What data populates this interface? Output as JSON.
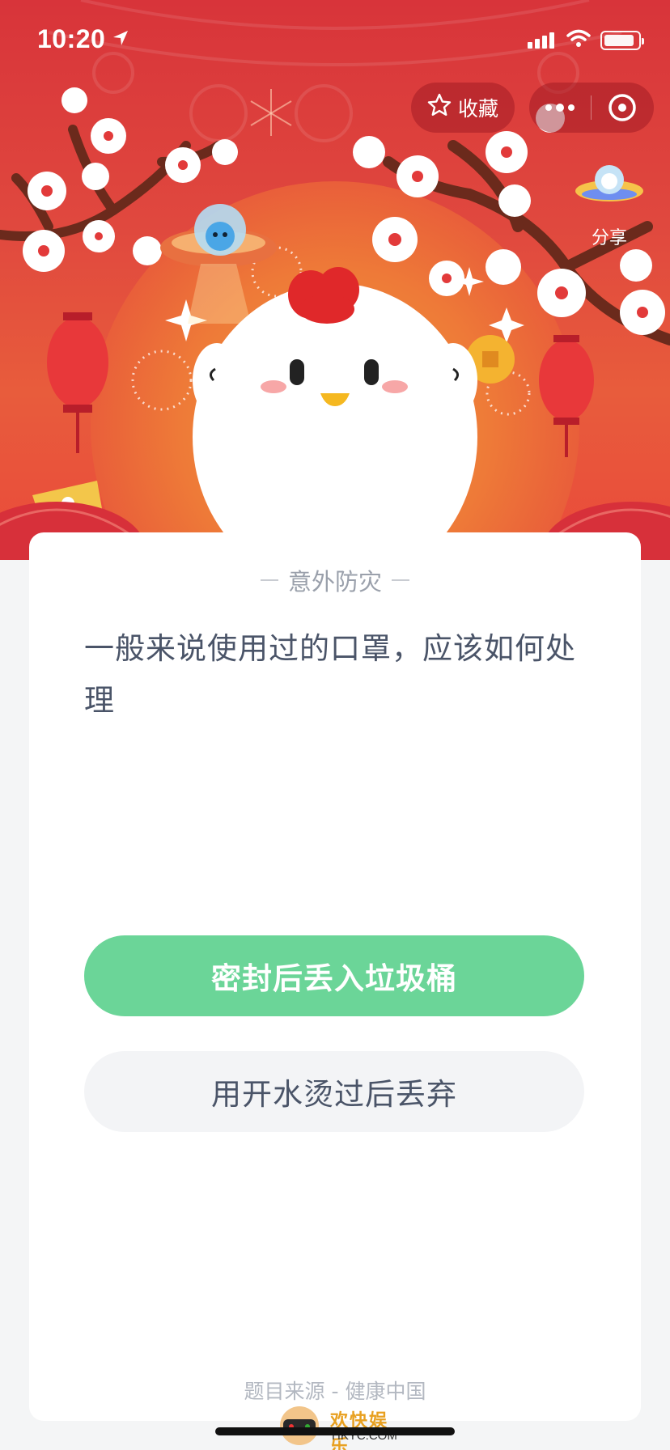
{
  "status_bar": {
    "time": "10:20"
  },
  "header": {
    "favorite_label": "收藏",
    "share_label": "分享"
  },
  "quiz": {
    "category": "意外防灾",
    "question": "一般来说使用过的口罩，应该如何处理",
    "options": [
      {
        "label": "密封后丢入垃圾桶",
        "state": "highlighted"
      },
      {
        "label": "用开水烫过后丢弃",
        "state": "default"
      }
    ],
    "source": "题目来源 - 健康中国"
  },
  "watermark": {
    "title": "欢快娱乐",
    "domain": "HKYC.COM"
  },
  "colors": {
    "banner_red": "#d8343a",
    "correct_green": "#6bd598",
    "text_dark": "#4a5468",
    "text_muted": "#9aa0ab"
  }
}
